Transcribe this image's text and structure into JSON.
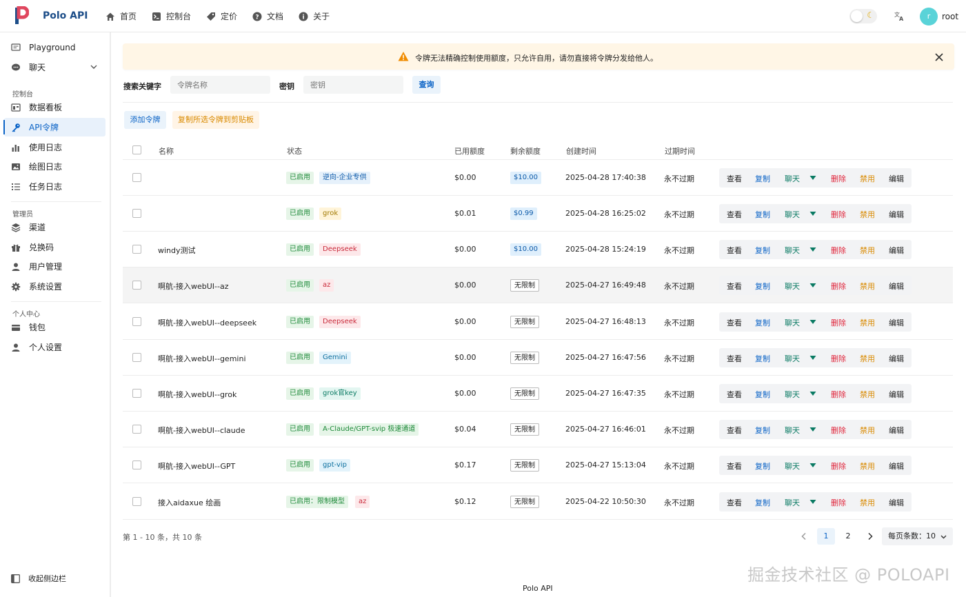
{
  "brand": {
    "name": "Polo API"
  },
  "topnav": [
    {
      "label": "首页",
      "icon": "home-icon"
    },
    {
      "label": "控制台",
      "icon": "terminal-icon"
    },
    {
      "label": "定价",
      "icon": "price-tag-icon"
    },
    {
      "label": "文档",
      "icon": "help-icon"
    },
    {
      "label": "关于",
      "icon": "info-icon"
    }
  ],
  "user": {
    "avatar_letter": "r",
    "name": "root"
  },
  "sidebar": {
    "playground": "Playground",
    "chat": "聊天",
    "group_console": "控制台",
    "dashboard": "数据看板",
    "api_tokens": "API令牌",
    "usage_logs": "使用日志",
    "draw_logs": "绘图日志",
    "task_logs": "任务日志",
    "group_admin": "管理员",
    "channels": "渠道",
    "redeem": "兑换码",
    "users": "用户管理",
    "settings": "系统设置",
    "group_personal": "个人中心",
    "wallet": "钱包",
    "personal_settings": "个人设置",
    "collapse": "收起侧边栏"
  },
  "alert": {
    "text": "令牌无法精确控制使用额度，只允许自用，请勿直接将令牌分发给他人。"
  },
  "search": {
    "label_keyword": "搜索关键字",
    "placeholder_name": "令牌名称",
    "label_key": "密钥",
    "placeholder_key": "密钥",
    "query_button": "查询"
  },
  "toolbar": {
    "add_button": "添加令牌",
    "copy_selected_button": "复制所选令牌到剪贴板"
  },
  "table": {
    "headers": {
      "name": "名称",
      "status": "状态",
      "used": "已用额度",
      "remaining": "剩余额度",
      "created": "创建时间",
      "expire": "过期时间"
    },
    "actions": {
      "view": "查看",
      "copy": "复制",
      "chat": "聊天",
      "delete": "删除",
      "disable": "禁用",
      "edit": "编辑"
    },
    "rows": [
      {
        "name": "",
        "status": "已启用",
        "group": "逆向-企业专供",
        "group_style": "blue",
        "used": "$0.00",
        "remaining": "$10.00",
        "remaining_style": "blue",
        "created": "2025-04-28 17:40:38",
        "expire": "永不过期"
      },
      {
        "name": "",
        "status": "已启用",
        "group": "grok",
        "group_style": "yellow",
        "used": "$0.01",
        "remaining": "$0.99",
        "remaining_style": "blue",
        "created": "2025-04-28 16:25:02",
        "expire": "永不过期"
      },
      {
        "name": "windy测试",
        "status": "已启用",
        "group": "Deepseek",
        "group_style": "red",
        "used": "$0.00",
        "remaining": "$10.00",
        "remaining_style": "blue",
        "created": "2025-04-28 15:24:19",
        "expire": "永不过期"
      },
      {
        "name": "啊航-接入webUI--az",
        "status": "已启用",
        "group": "az",
        "group_style": "red",
        "used": "$0.00",
        "remaining": "无限制",
        "remaining_style": "white",
        "created": "2025-04-27 16:49:48",
        "expire": "永不过期"
      },
      {
        "name": "啊航-接入webUI--deepseek",
        "status": "已启用",
        "group": "Deepseek",
        "group_style": "red",
        "used": "$0.00",
        "remaining": "无限制",
        "remaining_style": "white",
        "created": "2025-04-27 16:48:13",
        "expire": "永不过期"
      },
      {
        "name": "啊航-接入webUI--gemini",
        "status": "已启用",
        "group": "Gemini",
        "group_style": "lightblue",
        "used": "$0.00",
        "remaining": "无限制",
        "remaining_style": "white",
        "created": "2025-04-27 16:47:56",
        "expire": "永不过期"
      },
      {
        "name": "啊航-接入webUI--grok",
        "status": "已启用",
        "group": "grok官key",
        "group_style": "teal",
        "used": "$0.00",
        "remaining": "无限制",
        "remaining_style": "white",
        "created": "2025-04-27 16:47:35",
        "expire": "永不过期"
      },
      {
        "name": "啊航-接入webUI--claude",
        "status": "已启用",
        "group": "A-Claude/GPT-svip 极速通道",
        "group_style": "green",
        "used": "$0.04",
        "remaining": "无限制",
        "remaining_style": "white",
        "created": "2025-04-27 16:46:01",
        "expire": "永不过期"
      },
      {
        "name": "啊航-接入webUI--GPT",
        "status": "已启用",
        "group": "gpt-vip",
        "group_style": "lightblue",
        "used": "$0.17",
        "remaining": "无限制",
        "remaining_style": "white",
        "created": "2025-04-27 15:13:04",
        "expire": "永不过期"
      },
      {
        "name": "接入aidaxue 绘画",
        "status": "已启用：限制模型",
        "group": "az",
        "group_style": "red",
        "used": "$0.12",
        "remaining": "无限制",
        "remaining_style": "white",
        "created": "2025-04-22 10:50:30",
        "expire": "永不过期"
      }
    ]
  },
  "pagination": {
    "info": "第 1 - 10 条，共 10 条",
    "pages": [
      "1",
      "2"
    ],
    "current": "1",
    "page_size": "每页条数：10"
  },
  "footer": {
    "credit": "Polo API"
  },
  "watermark": "掘金技术社区 @ POLOAPI"
}
